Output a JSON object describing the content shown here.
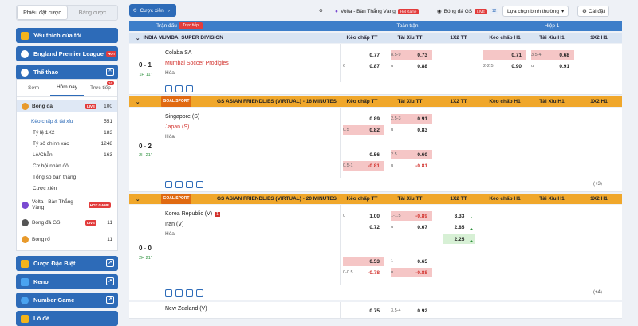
{
  "left": {
    "tabs": [
      "Phiếu đặt cược",
      "Bảng cược"
    ],
    "favorites": "Yêu thích của tôi",
    "epl": "England Premier League",
    "hot": "HOT",
    "sports": "Thể thao",
    "subtabs": [
      "Sớm",
      "Hôm nay",
      "Trực tiếp"
    ],
    "live_count": "16",
    "items": [
      {
        "label": "Bóng đá",
        "count": "100"
      },
      {
        "label": "Kèo chấp & tài xỉu",
        "count": "551"
      },
      {
        "label": "Tỷ lệ 1X2",
        "count": "183"
      },
      {
        "label": "Tỷ số chính xác",
        "count": "1248"
      },
      {
        "label": "Lẻ/Chẵn",
        "count": "163"
      },
      {
        "label": "Cơ hội nhân đôi",
        "count": ""
      },
      {
        "label": "Tổng số bàn thắng",
        "count": ""
      },
      {
        "label": "Cược xiên",
        "count": ""
      },
      {
        "label": "Volta - Bàn Thắng Vàng",
        "count": ""
      },
      {
        "label": "Bóng đá GS",
        "count": "11"
      },
      {
        "label": "Bóng rổ",
        "count": "11"
      }
    ],
    "hot_game": "HOT GAME",
    "live_tag": "LIVE",
    "special": "Cược Đặc Biệt",
    "keno": "Keno",
    "number_game": "Number Game",
    "lo_de": "Lô đề"
  },
  "toolbar": {
    "parlay": "Cược xiên",
    "volta": "Volta - Bàn Thắng Vàng",
    "volta_badge": "Hot Game",
    "gs": "Bóng đá GS",
    "gs_live": "LIVE",
    "gs_count": "12",
    "sort": "Lựa chọn bình thường",
    "settings": "Cài đặt"
  },
  "header": {
    "match": "Trận đấu",
    "live": "Trực tiếp",
    "full": "Toàn trận",
    "half": "Hiệp 1",
    "cols": [
      "Kèo chấp TT",
      "Tài Xỉu TT",
      "1X2 TT",
      "Kèo chấp H1",
      "Tài Xỉu H1",
      "1X2 H1"
    ]
  },
  "leagues": [
    {
      "name": "INDIA MUMBAI SUPER DIVISION"
    },
    {
      "name": "GS ASIAN FRIENDLIES (VIRTUAL) - 16 MINUTES",
      "logo": "GOAL SPORT"
    },
    {
      "name": "GS ASIAN FRIENDLIES (VIRTUAL) - 20 MINUTES",
      "logo": "GOAL SPORT"
    }
  ],
  "matches": [
    {
      "score": "0 - 1",
      "time": "1H 11'",
      "home": "Colaba SA",
      "away": "Mumbai Soccer Prodigies",
      "draw": "Hòa",
      "hc": [
        [
          "",
          "0.77"
        ],
        [
          "6",
          "0.87"
        ]
      ],
      "ou": [
        [
          "8.5-9",
          "0.73"
        ],
        [
          "u",
          "0.88"
        ]
      ],
      "hc1": [
        [
          "",
          "0.71"
        ],
        [
          "2-2.5",
          "0.90"
        ]
      ],
      "ou1": [
        [
          "3.5-4",
          "0.68"
        ],
        [
          "u",
          "0.91"
        ]
      ]
    },
    {
      "score": "0 - 2",
      "time": "2H 21'",
      "home": "Singapore (S)",
      "away": "Japan (S)",
      "draw": "Hòa",
      "hc": [
        [
          "",
          "0.89"
        ],
        [
          "0.5",
          "0.82"
        ]
      ],
      "ou": [
        [
          "2.5-3",
          "0.91"
        ],
        [
          "u",
          "0.83"
        ]
      ],
      "hc_b": [
        [
          "",
          "0.56"
        ],
        [
          "0.5-1",
          "-0.81"
        ]
      ],
      "ou_b": [
        [
          "2.5",
          "0.60"
        ],
        [
          "u",
          "-0.81"
        ]
      ],
      "more": "(+3)"
    },
    {
      "score": "0 - 0",
      "time": "2H 21'",
      "home": "Korea Republic (V)",
      "red": "1",
      "away": "Iran (V)",
      "draw": "Hòa",
      "hc": [
        [
          "0",
          "1.00"
        ],
        [
          "",
          "0.72"
        ]
      ],
      "ou": [
        [
          "1-1.5",
          "-0.89"
        ],
        [
          "u",
          "0.67"
        ]
      ],
      "x12": [
        "3.33",
        "2.85",
        "2.25"
      ],
      "hc_b": [
        [
          "",
          "0.53"
        ],
        [
          "0-0.5",
          "-0.78"
        ]
      ],
      "ou_b": [
        [
          "1",
          "0.65"
        ],
        [
          "u",
          "-0.88"
        ]
      ],
      "more": "(+4)"
    },
    {
      "home": "New Zealand (V)",
      "hc": [
        [
          "",
          "0.75"
        ]
      ],
      "ou": [
        [
          "3.5-4",
          "0.92"
        ]
      ]
    }
  ]
}
